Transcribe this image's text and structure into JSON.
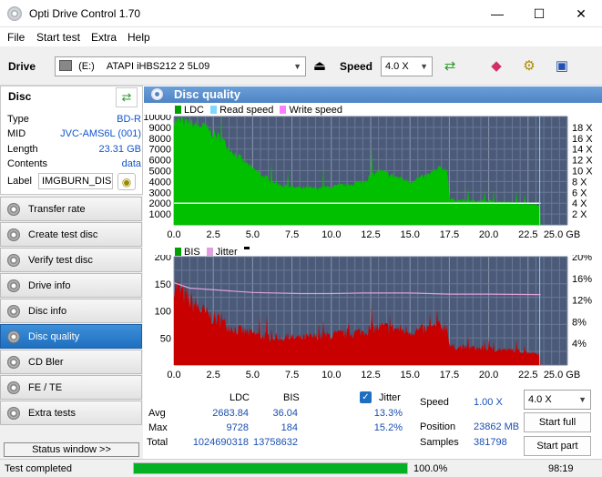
{
  "window": {
    "title": "Opti Drive Control 1.70",
    "minimize": "—",
    "maximize": "☐",
    "close": "✕"
  },
  "menu": [
    "File",
    "Start test",
    "Extra",
    "Help"
  ],
  "toolbar": {
    "drive_label": "Drive",
    "drive_letter": "(E:)",
    "drive_name": "ATAPI iHBS212  2 5L09",
    "speed_label": "Speed",
    "speed_value": "4.0 X"
  },
  "disc": {
    "header": "Disc",
    "rows": [
      {
        "label": "Type",
        "value": "BD-R"
      },
      {
        "label": "MID",
        "value": "JVC-AMS6L (001)"
      },
      {
        "label": "Length",
        "value": "23.31 GB"
      },
      {
        "label": "Contents",
        "value": "data"
      }
    ],
    "label_field_label": "Label",
    "label_value": "IMGBURN_DIS"
  },
  "nav": [
    {
      "label": "Transfer rate",
      "active": false
    },
    {
      "label": "Create test disc",
      "active": false
    },
    {
      "label": "Verify test disc",
      "active": false
    },
    {
      "label": "Drive info",
      "active": false
    },
    {
      "label": "Disc info",
      "active": false
    },
    {
      "label": "Disc quality",
      "active": true
    },
    {
      "label": "CD Bler",
      "active": false
    },
    {
      "label": "FE / TE",
      "active": false
    },
    {
      "label": "Extra tests",
      "active": false
    }
  ],
  "status_window_btn": "Status window >>",
  "panel_title": "Disc quality",
  "colors": {
    "ldc": "#00c000",
    "bis": "#c00000",
    "read_speed": "#80d8ff",
    "write_speed": "#ff80ff",
    "jitter": "#e0a0e0",
    "plot_bg": "#4a5a78",
    "accent": "#1f6fc0"
  },
  "chart_data": [
    {
      "type": "area",
      "legend": [
        "LDC",
        "Read speed",
        "Write speed"
      ],
      "x_ticks": [
        "0.0",
        "2.5",
        "5.0",
        "7.5",
        "10.0",
        "12.5",
        "15.0",
        "17.5",
        "20.0",
        "22.5",
        "25.0 GB"
      ],
      "y_left_ticks": [
        "10000",
        "9000",
        "8000",
        "7000",
        "6000",
        "5000",
        "4000",
        "3000",
        "2000",
        "1000"
      ],
      "y_right_ticks": [
        "18 X",
        "16 X",
        "14 X",
        "12 X",
        "10 X",
        "8 X",
        "6 X",
        "4 X",
        "2 X"
      ],
      "xlim": [
        0,
        25
      ],
      "ylim": [
        0,
        10000
      ],
      "ldc_x": [
        0,
        0.3,
        0.6,
        1,
        2,
        3,
        4,
        5,
        6,
        7,
        8,
        9,
        10,
        11,
        12,
        13,
        14,
        15,
        16,
        17,
        17.4,
        17.5,
        18,
        19,
        20,
        21,
        22,
        23,
        23.3
      ],
      "ldc_y": [
        9700,
        9600,
        9500,
        9400,
        9000,
        7900,
        6400,
        5200,
        4200,
        3600,
        3400,
        3400,
        3500,
        3700,
        4000,
        5000,
        4500,
        4000,
        4500,
        5300,
        5000,
        2400,
        2300,
        2200,
        2200,
        2100,
        2000,
        1900,
        1800
      ],
      "read_speed_x": [
        0,
        23.3
      ],
      "read_speed_y": [
        4.0,
        4.0
      ]
    },
    {
      "type": "area",
      "legend": [
        "BIS",
        "Jitter"
      ],
      "x_ticks": [
        "0.0",
        "2.5",
        "5.0",
        "7.5",
        "10.0",
        "12.5",
        "15.0",
        "17.5",
        "20.0",
        "22.5",
        "25.0 GB"
      ],
      "y_left_ticks": [
        "200",
        "150",
        "100",
        "50"
      ],
      "y_right_ticks": [
        "20%",
        "16%",
        "12%",
        "8%",
        "4%"
      ],
      "xlim": [
        0,
        25
      ],
      "ylim": [
        0,
        200
      ],
      "bis_x": [
        0,
        0.3,
        0.6,
        1,
        2,
        3,
        4,
        5,
        6,
        7,
        8,
        9,
        10,
        11,
        12,
        13,
        14,
        15,
        16,
        17,
        17.4,
        17.5,
        18,
        19,
        20,
        21,
        22,
        23,
        23.3
      ],
      "bis_y": [
        150,
        140,
        130,
        120,
        95,
        80,
        65,
        58,
        52,
        50,
        50,
        52,
        55,
        58,
        62,
        70,
        68,
        62,
        65,
        72,
        70,
        35,
        33,
        32,
        30,
        28,
        26,
        22,
        20
      ],
      "jitter_x": [
        0,
        1,
        3,
        5,
        8,
        10,
        12,
        15,
        17.5,
        20,
        23.3
      ],
      "jitter_y": [
        15.2,
        14.2,
        13.8,
        13.4,
        13.2,
        13.2,
        13.3,
        13.3,
        13.1,
        13.1,
        13.0
      ]
    }
  ],
  "stats": {
    "col_ldc": "LDC",
    "col_bis": "BIS",
    "jitter_label": "Jitter",
    "rows": [
      {
        "label": "Avg",
        "ldc": "2683.84",
        "bis": "36.04",
        "jitter": "13.3%"
      },
      {
        "label": "Max",
        "ldc": "9728",
        "bis": "184",
        "jitter": "15.2%"
      },
      {
        "label": "Total",
        "ldc": "1024690318",
        "bis": "13758632",
        "jitter": ""
      }
    ],
    "speed_label": "Speed",
    "speed_value": "1.00 X",
    "speed_select": "4.0 X",
    "position_label": "Position",
    "position_value": "23862 MB",
    "samples_label": "Samples",
    "samples_value": "381798",
    "start_full": "Start full",
    "start_part": "Start part"
  },
  "status": {
    "text": "Test completed",
    "progress": 100.0,
    "progress_text": "100.0%",
    "time": "98:19"
  }
}
